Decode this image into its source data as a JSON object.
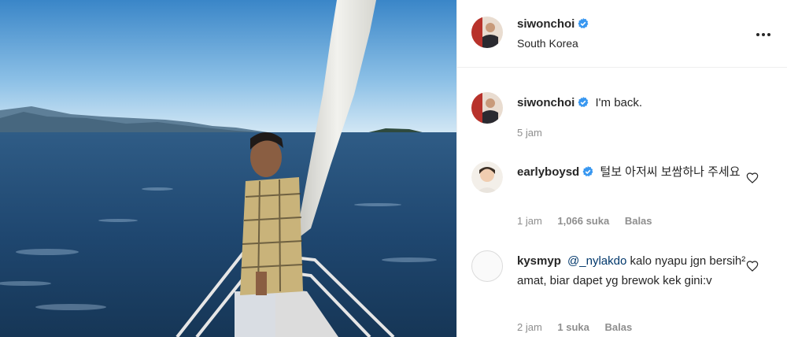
{
  "post": {
    "author": "siwonchoi",
    "location": "South Korea",
    "caption": "I'm back.",
    "time": "5 jam"
  },
  "comments": [
    {
      "username": "earlyboysd",
      "verified": true,
      "text": "털보 아저씨 보쌈하나 주세요",
      "time": "1 jam",
      "likes": "1,066 suka",
      "reply_label": "Balas"
    },
    {
      "username": "kysmyp",
      "verified": false,
      "mention": "@_nylakdo",
      "text": "kalo nyapu jgn bersih² amat, biar dapet yg brewok kek gini:v",
      "time": "2 jam",
      "likes": "1 suka",
      "reply_label": "Balas"
    }
  ],
  "icons": {
    "verified": "verified-badge-icon",
    "more": "more-options-icon",
    "like": "heart-outline-icon"
  },
  "colors": {
    "verified_blue": "#3897f0",
    "meta_gray": "#8e8e8e",
    "mention_blue": "#00376b"
  }
}
